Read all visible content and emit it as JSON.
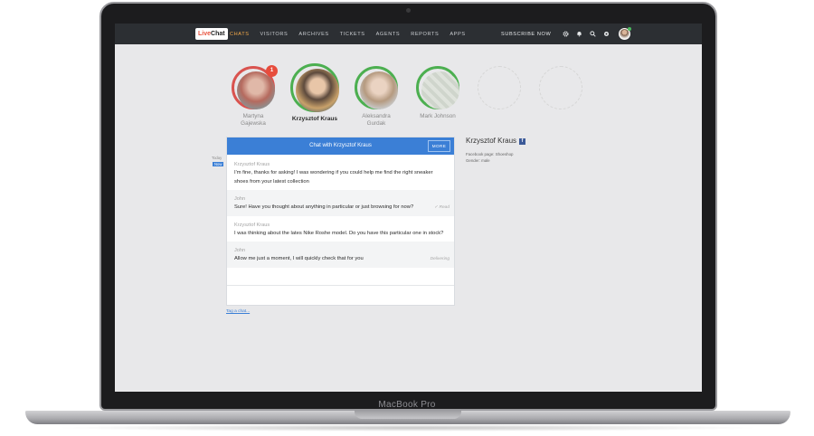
{
  "laptop": {
    "model_label": "MacBook Pro"
  },
  "app": {
    "logo": {
      "text_live": "Live",
      "text_chat": "Chat"
    },
    "nav": [
      {
        "label": "CHATS",
        "active": true
      },
      {
        "label": "VISITORS",
        "active": false
      },
      {
        "label": "ARCHIVES",
        "active": false
      },
      {
        "label": "TICKETS",
        "active": false
      },
      {
        "label": "AGENTS",
        "active": false
      },
      {
        "label": "REPORTS",
        "active": false
      },
      {
        "label": "APPS",
        "active": false
      }
    ],
    "subscribe_label": "SUBSCRIBE NOW",
    "nav_icons": [
      "gear-icon",
      "bell-icon",
      "search-icon",
      "settings-icon"
    ]
  },
  "visitors": [
    {
      "first": "Martyna",
      "last": "Gajewska",
      "ring": "red",
      "badge": "1"
    },
    {
      "first": "Krzysztof Kraus",
      "last": "",
      "ring": "green",
      "active": true
    },
    {
      "first": "Aleksandra",
      "last": "Gurdak",
      "ring": "green"
    },
    {
      "first": "Mark Johnson",
      "last": "",
      "ring": "green"
    },
    {
      "first": "",
      "last": "",
      "ring": "empty"
    },
    {
      "first": "",
      "last": "",
      "ring": "empty"
    }
  ],
  "chat": {
    "title": "Chat with Krzysztof Kraus",
    "more_label": "MORE",
    "side_tabs": [
      "Today",
      "Now"
    ],
    "messages": [
      {
        "author": "Krzysztof Kraus",
        "text": "I'm fine, thanks for asking! I was wondering if you could help me find the right sneaker shoes from your latest collection",
        "status": ""
      },
      {
        "author": "John",
        "text": "Sure! Have you thought about anything in particular or just browsing for now?",
        "status": "✓ Read"
      },
      {
        "author": "Krzysztof Kraus",
        "text": "I was thinking about the lates Nike Roshe model. Do you have this particular one in stock?",
        "status": ""
      },
      {
        "author": "John",
        "text": "Allow me just a moment, I will quickly check that for you",
        "status": "Delivering"
      }
    ],
    "footer_link": "Tag a chat..."
  },
  "customer": {
    "name": "Krzysztof Kraus",
    "line1": "Facebook page: Shoeshop",
    "line2": "Gender: male"
  }
}
